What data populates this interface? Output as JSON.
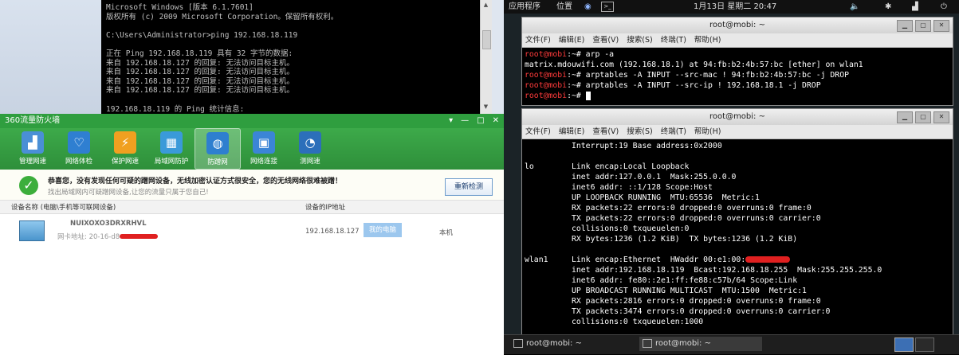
{
  "windows_cmd": {
    "lines": [
      "Microsoft Windows [版本 6.1.7601]",
      "版权所有 (c) 2009 Microsoft Corporation。保留所有权利。",
      "",
      "C:\\Users\\Administrator>ping 192.168.18.119",
      "",
      "正在 Ping 192.168.18.119 具有 32 字节的数据:",
      "来自 192.168.18.127 的回复: 无法访问目标主机。",
      "来自 192.168.18.127 的回复: 无法访问目标主机。",
      "来自 192.168.18.127 的回复: 无法访问目标主机。",
      "来自 192.168.18.127 的回复: 无法访问目标主机。",
      "",
      "192.168.18.119 的 Ping 统计信息:"
    ]
  },
  "firewall": {
    "title": "360流量防火墙",
    "controls": [
      "▾",
      "—",
      "□",
      "✕"
    ],
    "tools": [
      {
        "label": "管理网速",
        "icon": "chart-icon",
        "color": "#4a8fd6"
      },
      {
        "label": "网络体检",
        "icon": "pulse-icon",
        "color": "#2f7fd1"
      },
      {
        "label": "保护网速",
        "icon": "lightning-icon",
        "color": "#f0a020"
      },
      {
        "label": "局域网防护",
        "icon": "wall-icon",
        "color": "#3a9ad9"
      },
      {
        "label": "防蹭网",
        "icon": "shield-globe-icon",
        "color": "#2e7fcf"
      },
      {
        "label": "网络连接",
        "icon": "network-icon",
        "color": "#3b85d6"
      },
      {
        "label": "测网速",
        "icon": "speedometer-icon",
        "color": "#2c6fba"
      }
    ],
    "notice_main": "恭喜您，没有发现任何可疑的蹭网设备，无线加密认证方式很安全，您的无线网络很难被蹭！",
    "notice_sub": "找出局域网内可疑蹭网设备,让您的流量只属于您自己!",
    "recheck": "重新检测",
    "col_device": "设备名称 (电脑\\手机等可联网设备)",
    "col_ip": "设备的IP地址",
    "device_name": "NUIXOXO3DRXRHVL",
    "device_mac": "网卡地址: 20-16-d8-",
    "device_ip": "192.168.18.127",
    "my_pc": "我的电脑",
    "local": "本机"
  },
  "kali": {
    "panel": {
      "apps": "应用程序",
      "places": "位置",
      "datetime": "1月13日 星期二 20:47"
    },
    "term1": {
      "title": "root@mobi: ~",
      "menu": [
        "文件(F)",
        "编辑(E)",
        "查看(V)",
        "搜索(S)",
        "终端(T)",
        "帮助(H)"
      ],
      "prompt": "root@mobi",
      "lines": [
        {
          "prompt": true,
          "text": ":~# arp -a"
        },
        {
          "prompt": false,
          "text": "matrix.mdouwifi.com (192.168.18.1) at 94:fb:b2:4b:57:bc [ether] on wlan1"
        },
        {
          "prompt": true,
          "text": ":~# arptables -A INPUT --src-mac ! 94:fb:b2:4b:57:bc -j DROP"
        },
        {
          "prompt": true,
          "text": ":~# arptables -A INPUT --src-ip ! 192.168.18.1 -j DROP"
        },
        {
          "prompt": true,
          "text": ":~# "
        }
      ]
    },
    "term2": {
      "title": "root@mobi: ~",
      "menu": [
        "文件(F)",
        "编辑(E)",
        "查看(V)",
        "搜索(S)",
        "终端(T)",
        "帮助(H)"
      ],
      "lines": [
        "          Interrupt:19 Base address:0x2000",
        "",
        "lo        Link encap:Local Loopback",
        "          inet addr:127.0.0.1  Mask:255.0.0.0",
        "          inet6 addr: ::1/128 Scope:Host",
        "          UP LOOPBACK RUNNING  MTU:65536  Metric:1",
        "          RX packets:22 errors:0 dropped:0 overruns:0 frame:0",
        "          TX packets:22 errors:0 dropped:0 overruns:0 carrier:0",
        "          collisions:0 txqueuelen:0",
        "          RX bytes:1236 (1.2 KiB)  TX bytes:1236 (1.2 KiB)",
        "",
        "wlan1     Link encap:Ethernet  HWaddr 00:e1:00:",
        "          inet addr:192.168.18.119  Bcast:192.168.18.255  Mask:255.255.255.0",
        "          inet6 addr: fe80::2e1:ff:fe88:c57b/64 Scope:Link",
        "          UP BROADCAST RUNNING MULTICAST  MTU:1500  Metric:1",
        "          RX packets:2816 errors:0 dropped:0 overruns:0 frame:0",
        "          TX packets:3474 errors:0 dropped:0 overruns:0 carrier:0",
        "          collisions:0 txqueuelen:1000"
      ]
    },
    "taskbar": [
      "root@mobi: ~",
      "root@mobi: ~"
    ]
  }
}
